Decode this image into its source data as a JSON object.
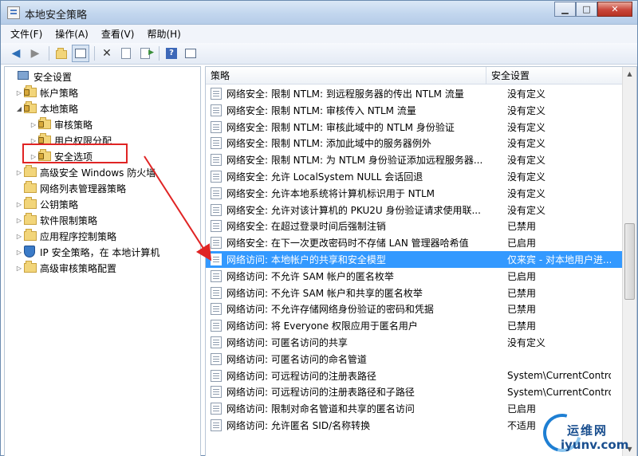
{
  "window": {
    "title": "本地安全策略"
  },
  "menu": {
    "file": "文件(F)",
    "action": "操作(A)",
    "view": "查看(V)",
    "help": "帮助(H)"
  },
  "toolbar": {
    "help_glyph": "?"
  },
  "tree": {
    "root": "安全设置",
    "account_policy": "帐户策略",
    "local_policy": "本地策略",
    "audit_policy": "审核策略",
    "user_rights": "用户权限分配",
    "security_options": "安全选项",
    "firewall": "高级安全 Windows 防火墙",
    "network_list": "网络列表管理器策略",
    "public_key": "公钥策略",
    "software_restriction": "软件限制策略",
    "app_control": "应用程序控制策略",
    "ip_security": "IP 安全策略，在 本地计算机",
    "audit_config": "高级审核策略配置"
  },
  "columns": {
    "policy": "策略",
    "setting": "安全设置"
  },
  "policies": [
    {
      "name": "网络安全: 限制 NTLM: 到远程服务器的传出 NTLM 流量",
      "value": "没有定义"
    },
    {
      "name": "网络安全: 限制 NTLM: 审核传入 NTLM 流量",
      "value": "没有定义"
    },
    {
      "name": "网络安全: 限制 NTLM: 审核此域中的 NTLM 身份验证",
      "value": "没有定义"
    },
    {
      "name": "网络安全: 限制 NTLM: 添加此域中的服务器例外",
      "value": "没有定义"
    },
    {
      "name": "网络安全: 限制 NTLM: 为 NTLM 身份验证添加远程服务器...",
      "value": "没有定义"
    },
    {
      "name": "网络安全: 允许 LocalSystem NULL 会话回退",
      "value": "没有定义"
    },
    {
      "name": "网络安全: 允许本地系统将计算机标识用于 NTLM",
      "value": "没有定义"
    },
    {
      "name": "网络安全: 允许对该计算机的 PKU2U 身份验证请求使用联...",
      "value": "没有定义"
    },
    {
      "name": "网络安全: 在超过登录时间后强制注销",
      "value": "已禁用"
    },
    {
      "name": "网络安全: 在下一次更改密码时不存储 LAN 管理器哈希值",
      "value": "已启用"
    },
    {
      "name": "网络访问: 本地帐户的共享和安全模型",
      "value": "仅来宾 - 对本地用户进..."
    },
    {
      "name": "网络访问: 不允许 SAM 帐户的匿名枚举",
      "value": "已启用"
    },
    {
      "name": "网络访问: 不允许 SAM 帐户和共享的匿名枚举",
      "value": "已禁用"
    },
    {
      "name": "网络访问: 不允许存储网络身份验证的密码和凭据",
      "value": "已禁用"
    },
    {
      "name": "网络访问: 将 Everyone 权限应用于匿名用户",
      "value": "已禁用"
    },
    {
      "name": "网络访问: 可匿名访问的共享",
      "value": "没有定义"
    },
    {
      "name": "网络访问: 可匿名访问的命名管道",
      "value": ""
    },
    {
      "name": "网络访问: 可远程访问的注册表路径",
      "value": "System\\CurrentContro..."
    },
    {
      "name": "网络访问: 可远程访问的注册表路径和子路径",
      "value": "System\\CurrentContro..."
    },
    {
      "name": "网络访问: 限制对命名管道和共享的匿名访问",
      "value": "已启用"
    },
    {
      "name": "网络访问: 允许匿名 SID/名称转换",
      "value": "不适用"
    }
  ],
  "selected_index": 10,
  "watermark": {
    "title": "运维网",
    "url": "iyunv.com"
  },
  "colors": {
    "selection": "#3399ff",
    "highlight_box": "#e02424"
  }
}
